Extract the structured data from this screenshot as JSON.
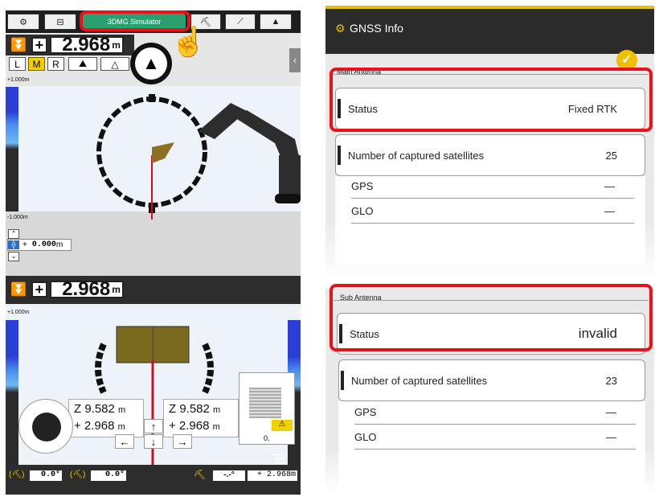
{
  "left_screen": {
    "top_tabs": [
      "⚙",
      "⊟",
      "3DMG Simulator"
    ],
    "height_value": "2.968",
    "height_unit": "m",
    "sign": "+",
    "modes": [
      "L",
      "M",
      "R"
    ],
    "scale_top": "+1.000m",
    "scale_bottom": "-1.000m",
    "offset_value": "0.000",
    "offset_unit": "m",
    "offset_sign": "+",
    "lower_height_value": "2.968",
    "lower_height_unit": "m",
    "lower_sign": "+",
    "lower_scale_top": "+1.000m",
    "left_z": "Z 9.582",
    "left_z_unit": "m",
    "left_h": "+ 2.968",
    "left_h_unit": "m",
    "right_z": "Z 9.582",
    "right_z_unit": "m",
    "right_h": "+ 2.968",
    "right_h_unit": "m",
    "minimap_label": "0.",
    "bottom_angle1": "0.0°",
    "bottom_angle2": "0.0°",
    "bottom_dash": "-.-°",
    "bottom_value": "+ 2.968m",
    "arrows": {
      "up": "↑",
      "down": "↓",
      "left": "←",
      "right": "→"
    }
  },
  "right_screen": {
    "title": "GNSS Info",
    "main_antenna_label": "Main Antenna",
    "main_status_label": "Status",
    "main_status_value": "Fixed RTK",
    "main_sats_label": "Number of captured satellites",
    "main_sats_value": "25",
    "main_gps_label": "GPS",
    "main_gps_value": "—",
    "main_glo_label": "GLO",
    "main_glo_value": "—",
    "sub_antenna_label": "Sub Antenna",
    "sub_status_label": "Status",
    "sub_status_value": "invalid",
    "sub_sats_label": "Number of captured satellites",
    "sub_sats_value": "23",
    "sub_gps_label": "GPS",
    "sub_gps_value": "—",
    "sub_glo_label": "GLO",
    "sub_glo_value": "—"
  },
  "colors": {
    "highlight": "#e8121a",
    "simulator_tab": "#2aa070",
    "excavator": "#2d2d2d",
    "bucket": "#7a6a1e"
  }
}
